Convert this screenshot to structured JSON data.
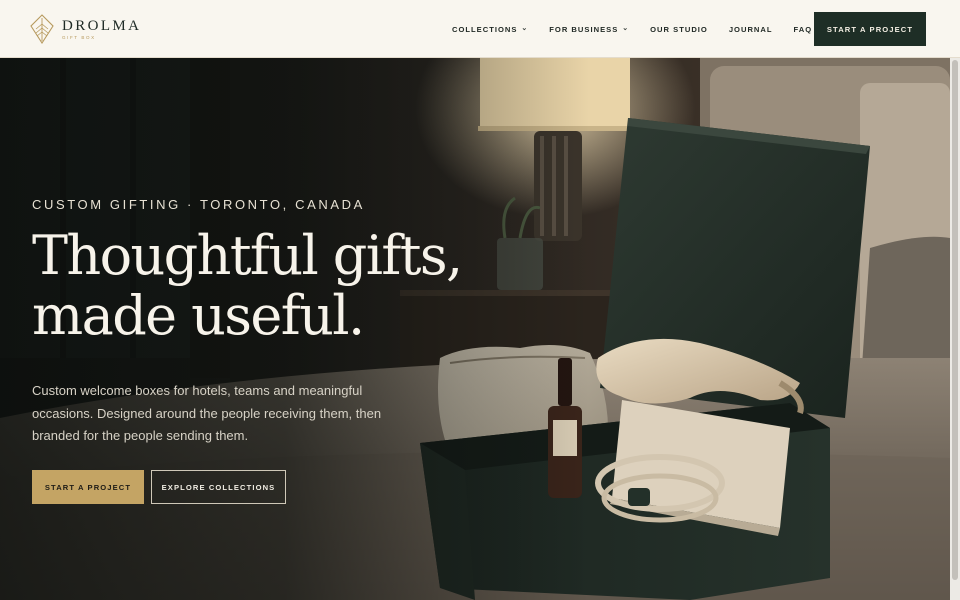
{
  "brand": {
    "name": "DROLMA",
    "tagline": "GIFT BOX",
    "logo_icon": "leaf-diamond-icon"
  },
  "nav": {
    "items": [
      {
        "label": "COLLECTIONS",
        "has_dropdown": true
      },
      {
        "label": "FOR BUSINESS",
        "has_dropdown": true
      },
      {
        "label": "OUR STUDIO",
        "has_dropdown": false
      },
      {
        "label": "JOURNAL",
        "has_dropdown": false
      },
      {
        "label": "FAQ",
        "has_dropdown": false
      }
    ],
    "chevron": "⌄",
    "cta_label": "START A PROJECT"
  },
  "hero": {
    "eyebrow": "CUSTOM GIFTING · TORONTO, CANADA",
    "headline_line1": "Thoughtful gifts,",
    "headline_line2": "made useful.",
    "lede": "Custom welcome boxes for hotels, teams and meaningful occasions. Designed around the people receiving them, then branded for the people sending them.",
    "primary_label": "START A PROJECT",
    "secondary_label": "EXPLORE COLLECTIONS"
  },
  "colors": {
    "header_bg": "#f9f6ef",
    "brand_green": "#1e2e26",
    "gold": "#c4a464",
    "cream_text": "#f7f3ea"
  }
}
